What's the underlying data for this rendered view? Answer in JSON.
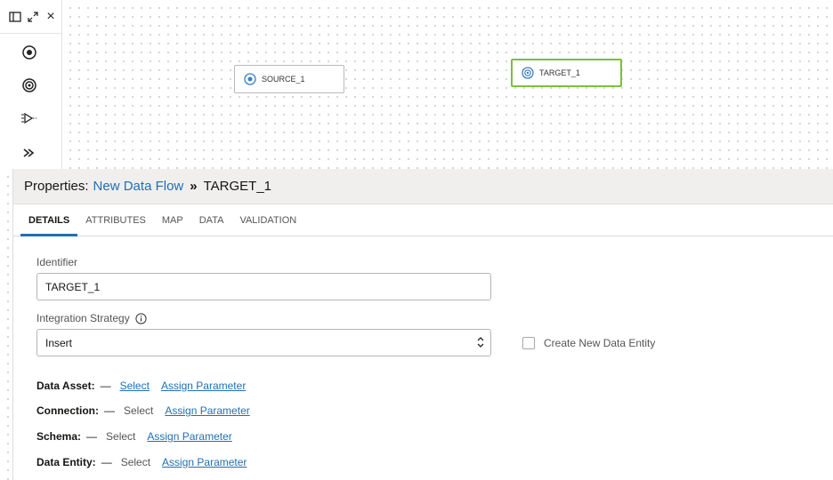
{
  "palette": {
    "header_icons": [
      "panel-toggle-icon",
      "expand-icon",
      "close-icon"
    ],
    "close_label": "×",
    "tools": [
      "source-operator-icon",
      "target-operator-icon",
      "filter-operator-icon",
      "join-arrow-icon"
    ]
  },
  "canvas": {
    "nodes": [
      {
        "label": "SOURCE_1",
        "selected": false
      },
      {
        "label": "TARGET_1",
        "selected": true
      }
    ]
  },
  "properties": {
    "title_prefix": "Properties:",
    "flow_name": "New Data Flow",
    "separator": "»",
    "selected_node": "TARGET_1",
    "tabs": [
      "DETAILS",
      "ATTRIBUTES",
      "MAP",
      "DATA",
      "VALIDATION"
    ],
    "active_tab": "DETAILS",
    "identifier_label": "Identifier",
    "identifier_value": "TARGET_1",
    "strategy_label": "Integration Strategy",
    "strategy_value": "Insert",
    "create_entity_label": "Create New Data Entity",
    "rows": [
      {
        "key": "Data Asset:",
        "dash": "—",
        "select": "Select",
        "param": "Assign Parameter"
      },
      {
        "key": "Connection:",
        "dash": "—",
        "select": "Select",
        "param": "Assign Parameter"
      },
      {
        "key": "Schema:",
        "dash": "—",
        "select": "Select",
        "param": "Assign Parameter"
      },
      {
        "key": "Data Entity:",
        "dash": "—",
        "select": "Select",
        "param": "Assign Parameter"
      }
    ]
  },
  "colors": {
    "accent": "#1f6fb5",
    "selected_border": "#7cbf3c",
    "header_bg": "#f1efed"
  }
}
